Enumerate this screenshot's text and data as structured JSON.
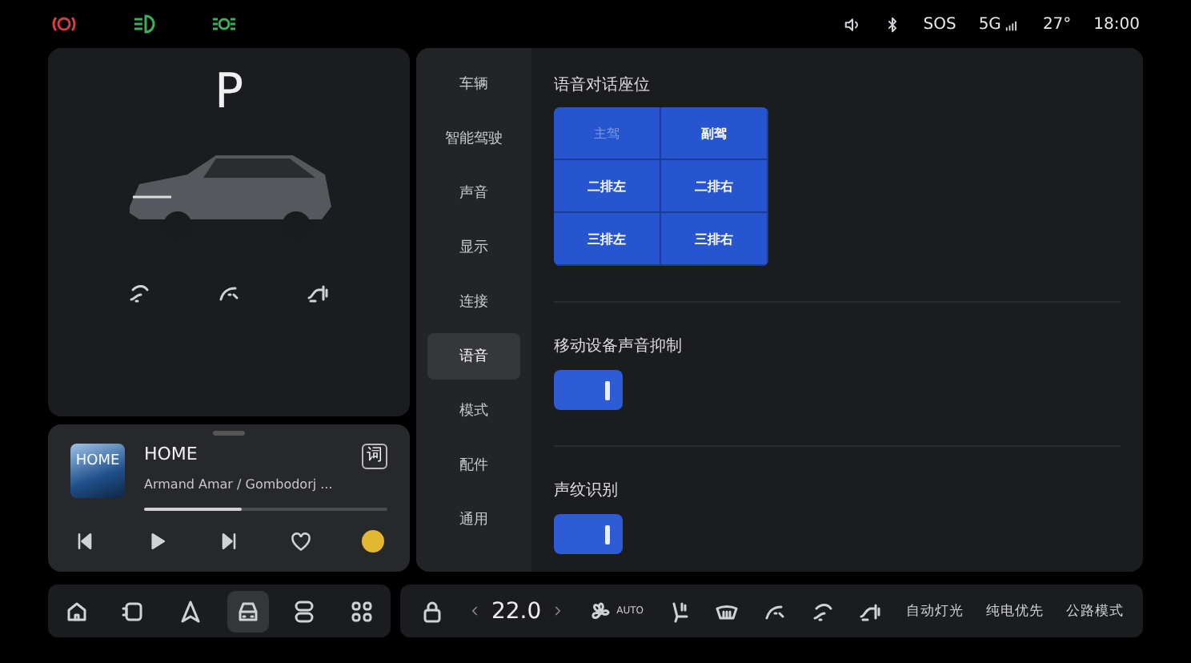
{
  "status_bar": {
    "indicators": [
      {
        "kind": "brake",
        "color": "#d04040"
      },
      {
        "kind": "headlight",
        "color": "#3fae5a"
      },
      {
        "kind": "parking",
        "color": "#3fae5a"
      }
    ],
    "sos": "SOS",
    "network": "5G",
    "temperature": "27°",
    "time": "18:00"
  },
  "vehicle": {
    "gear": "P"
  },
  "media": {
    "title": "HOME",
    "artist": "Armand Amar / Gombodorj ...",
    "cover_text": "HOME",
    "lyrics_button": "词",
    "level": 0.4,
    "favorite": false
  },
  "settings_nav": [
    {
      "label": "车辆",
      "selected": false
    },
    {
      "label": "智能驾驶",
      "selected": false
    },
    {
      "label": "声音",
      "selected": false
    },
    {
      "label": "显示",
      "selected": false
    },
    {
      "label": "连接",
      "selected": false
    },
    {
      "label": "语音",
      "selected": true
    },
    {
      "label": "模式",
      "selected": false
    },
    {
      "label": "配件",
      "selected": false
    },
    {
      "label": "通用",
      "selected": false
    }
  ],
  "voice_seat": {
    "title": "语音对话座位",
    "seats": [
      {
        "label": "主驾",
        "disabled": true
      },
      {
        "label": "副驾",
        "disabled": false
      },
      {
        "label": "二排左",
        "disabled": false
      },
      {
        "label": "二排右",
        "disabled": false
      },
      {
        "label": "三排左",
        "disabled": false
      },
      {
        "label": "三排右",
        "disabled": false
      }
    ]
  },
  "toggles": [
    {
      "title": "移动设备声音抑制",
      "on": true
    },
    {
      "title": "声纹识别",
      "on": true
    }
  ],
  "dock": {
    "apps": [
      {
        "kind": "home",
        "selected": false
      },
      {
        "kind": "seat",
        "selected": false
      },
      {
        "kind": "navigation",
        "selected": false
      },
      {
        "kind": "car",
        "selected": true
      },
      {
        "kind": "switch",
        "selected": false
      },
      {
        "kind": "apps",
        "selected": false
      }
    ],
    "temperature": "22.0",
    "fan_mode": "AUTO",
    "shortcuts": [
      "自动灯光",
      "纯电优先",
      "公路模式"
    ]
  }
}
